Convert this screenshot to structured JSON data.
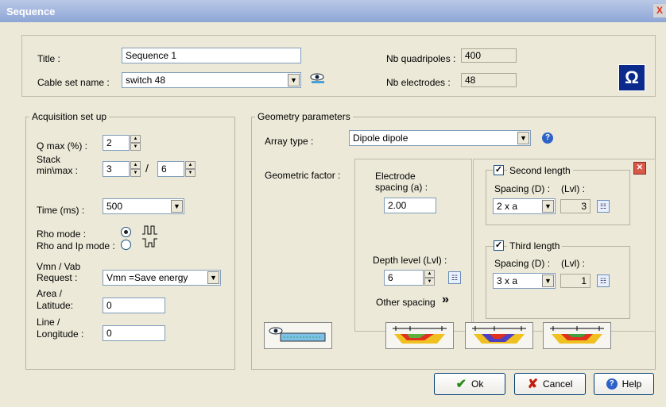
{
  "window": {
    "title": "Sequence",
    "close_glyph": "X"
  },
  "header": {
    "title_label": "Title :",
    "title_value": "Sequence 1",
    "cable_label": "Cable set name :",
    "cable_value": "switch 48",
    "nbq_label": "Nb quadripoles :",
    "nbq_value": "400",
    "nbe_label": "Nb electrodes :",
    "nbe_value": "48",
    "omega_glyph": "Ω"
  },
  "acquisition": {
    "legend": "Acquisition set up",
    "qmax_label": "Q max (%) :",
    "qmax_value": "2",
    "stack_label_1": "Stack",
    "stack_label_2": "min\\max :",
    "stack_min": "3",
    "stack_sep": "/",
    "stack_max": "6",
    "time_label": "Time (ms) :",
    "time_value": "500",
    "rho_mode_label": "Rho mode :",
    "rho_ip_label": "Rho and Ip mode :",
    "rho_mode_selected": "rho",
    "vmn_label_1": "Vmn / Vab",
    "vmn_label_2": "Request :",
    "vmn_value": "Vmn =Save energy",
    "area_label_1": "Area /",
    "area_label_2": "Latitude:",
    "area_value": "0",
    "line_label_1": "Line /",
    "line_label_2": "Longitude :",
    "line_value": "0"
  },
  "geometry": {
    "legend": "Geometry parameters",
    "array_label": "Array type :",
    "array_value": "Dipole dipole",
    "factor_label": "Geometric factor :",
    "electrode_label_1": "Electrode",
    "electrode_label_2": "spacing  (a) :",
    "electrode_value": "2.00",
    "depth_label": "Depth level  (Lvl) :",
    "depth_value": "6",
    "other_spacing": "Other spacing",
    "other_spacing_glyph": "»",
    "second": {
      "label": "Second length",
      "checked": true,
      "spacing_label": "Spacing (D) :",
      "lvl_label": "(Lvl) :",
      "spacing_value": "2 x a",
      "lvl_value": "3"
    },
    "third": {
      "label": "Third length",
      "checked": true,
      "spacing_label": "Spacing (D) :",
      "lvl_label": "(Lvl) :",
      "spacing_value": "3 x a",
      "lvl_value": "1"
    }
  },
  "buttons": {
    "ok": "Ok",
    "cancel": "Cancel",
    "help": "Help"
  },
  "colors": {
    "titlebar": "#8ea6d6",
    "omega_bg": "#0a2a8c",
    "ok_check": "#2a8a1a",
    "cancel_x": "#c02010",
    "help_icon": "#2e62c8"
  },
  "icons": [
    "eye-icon",
    "help-icon",
    "close-icon",
    "omega-icon",
    "calculator-icon",
    "pseudosection-icon"
  ]
}
